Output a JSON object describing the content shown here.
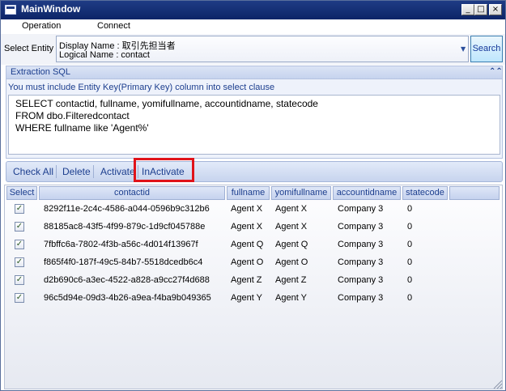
{
  "window": {
    "title": "MainWindow",
    "controls": {
      "minimize": "_",
      "maximize": "□",
      "close": "×"
    }
  },
  "menu": {
    "items": [
      "Operation",
      "Connect"
    ]
  },
  "entity": {
    "label": "Select Entity",
    "display_name": "Display Name : 取引先担当者",
    "logical_name": "Logical Name : contact",
    "search_label": "Search"
  },
  "sql": {
    "header": "Extraction SQL",
    "note": "You must include Entity Key(Primary Key) column into select clause",
    "lines": [
      "SELECT  contactid, fullname, yomifullname, accountidname, statecode",
      "FROM dbo.Filteredcontact",
      "WHERE fullname like 'Agent%'"
    ]
  },
  "toolbar": {
    "check_all": "Check All",
    "delete": "Delete",
    "activate": "Activate",
    "inactivate": "InActivate"
  },
  "grid": {
    "columns": [
      "Select",
      "contactid",
      "fullname",
      "yomifullname",
      "accountidname",
      "statecode"
    ],
    "rows": [
      {
        "checked": true,
        "contactid": "8292f11e-2c4c-4586-a044-0596b9c312b6",
        "fullname": "Agent X",
        "yomifullname": "Agent X",
        "accountidname": "Company 3",
        "statecode": "0"
      },
      {
        "checked": true,
        "contactid": "88185ac8-43f5-4f99-879c-1d9cf045788e",
        "fullname": "Agent X",
        "yomifullname": "Agent X",
        "accountidname": "Company 3",
        "statecode": "0"
      },
      {
        "checked": true,
        "contactid": "7fbffc6a-7802-4f3b-a56c-4d014f13967f",
        "fullname": "Agent Q",
        "yomifullname": "Agent Q",
        "accountidname": "Company 3",
        "statecode": "0"
      },
      {
        "checked": true,
        "contactid": "f865f4f0-187f-49c5-84b7-5518dcedb6c4",
        "fullname": "Agent O",
        "yomifullname": "Agent O",
        "accountidname": "Company 3",
        "statecode": "0"
      },
      {
        "checked": true,
        "contactid": "d2b690c6-a3ec-4522-a828-a9cc27f4d688",
        "fullname": "Agent Z",
        "yomifullname": "Agent Z",
        "accountidname": "Company 3",
        "statecode": "0"
      },
      {
        "checked": true,
        "contactid": "96c5d94e-09d3-4b26-a9ea-f4ba9b049365",
        "fullname": "Agent Y",
        "yomifullname": "Agent Y",
        "accountidname": "Company 3",
        "statecode": "0"
      }
    ],
    "check_glyph": "✓"
  },
  "colors": {
    "title_bar": "#1f3c85",
    "accent_text": "#1c3e8e",
    "highlight_border": "#e0131a"
  },
  "icons": {
    "window_icon": "window-icon",
    "collapse": "double-chevron-up-icon",
    "dropdown": "triangle-down-icon",
    "resize_grip": "resize-grip-icon"
  }
}
